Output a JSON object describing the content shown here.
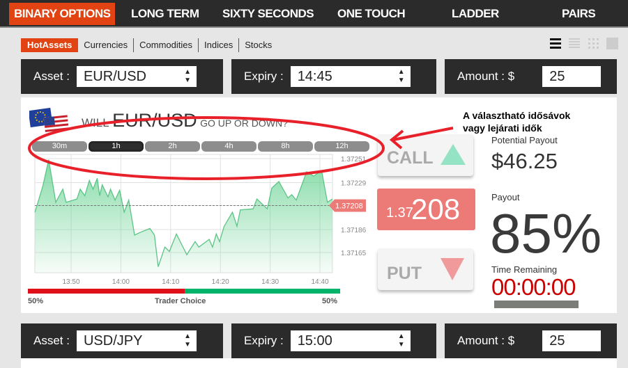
{
  "nav": {
    "items": [
      "BINARY OPTIONS",
      "LONG TERM",
      "SIXTY SECONDS",
      "ONE TOUCH",
      "LADDER",
      "PAIRS"
    ],
    "active": "BINARY OPTIONS",
    "accent": "#e24312"
  },
  "subnav": {
    "items": [
      "HotAssets",
      "Currencies",
      "Commodities",
      "Indices",
      "Stocks"
    ],
    "active": "HotAssets"
  },
  "view_icons": [
    "list-view-icon",
    "compact-list-icon",
    "grid-view-icon",
    "tile-view-icon"
  ],
  "trade1": {
    "asset_label": "Asset :",
    "asset": "EUR/USD",
    "expiry_label": "Expiry :",
    "expiry": "14:45",
    "amount_label": "Amount : $",
    "amount": "25"
  },
  "trade2": {
    "asset_label": "Asset :",
    "asset": "USD/JPY",
    "expiry_label": "Expiry :",
    "expiry": "15:00",
    "amount_label": "Amount : $",
    "amount": "25"
  },
  "question": {
    "will": "WILL",
    "pair": "EUR/USD",
    "rest": "GO UP OR DOWN?"
  },
  "timeframes": [
    "30m",
    "1h",
    "2h",
    "4h",
    "8h",
    "12h"
  ],
  "active_timeframe": "1h",
  "chart_data": {
    "type": "area",
    "x_ticks": [
      "13:50",
      "14:00",
      "14:10",
      "14:20",
      "14:30",
      "14:40"
    ],
    "y_ticks": [
      "1.37251",
      "1.37229",
      "1.37208",
      "1.37186",
      "1.37165"
    ],
    "current_price": "1.37208",
    "series_color": "#5ccf8a",
    "points": [
      [
        "13:42:45",
        1.37202
      ],
      [
        "13:44:20",
        1.37226
      ],
      [
        "13:45:30",
        1.3725
      ],
      [
        "13:46:55",
        1.37211
      ],
      [
        "13:48:20",
        1.37223
      ],
      [
        "13:49:00",
        1.37211
      ],
      [
        "13:51:10",
        1.37214
      ],
      [
        "13:51:50",
        1.37223
      ],
      [
        "13:52:45",
        1.37217
      ],
      [
        "13:53:40",
        1.37231
      ],
      [
        "13:54:25",
        1.37223
      ],
      [
        "13:55:15",
        1.37233
      ],
      [
        "13:55:45",
        1.37217
      ],
      [
        "13:56:15",
        1.37227
      ],
      [
        "13:57:25",
        1.37216
      ],
      [
        "13:57:55",
        1.37223
      ],
      [
        "13:58:50",
        1.37213
      ],
      [
        "13:59:45",
        1.37222
      ],
      [
        "14:00:40",
        1.37202
      ],
      [
        "14:01:35",
        1.37213
      ],
      [
        "14:02:45",
        1.37181
      ],
      [
        "14:04:10",
        1.37184
      ],
      [
        "14:05:50",
        1.37187
      ],
      [
        "14:06:45",
        1.37181
      ],
      [
        "14:07:30",
        1.37152
      ],
      [
        "14:08:50",
        1.3717
      ],
      [
        "14:09:45",
        1.37166
      ],
      [
        "14:11:10",
        1.37182
      ],
      [
        "14:13:15",
        1.37163
      ],
      [
        "14:14:55",
        1.37175
      ],
      [
        "14:15:40",
        1.3717
      ],
      [
        "14:17:45",
        1.37177
      ],
      [
        "14:18:25",
        1.3717
      ],
      [
        "14:19:10",
        1.37182
      ],
      [
        "14:19:50",
        1.37175
      ],
      [
        "14:20:45",
        1.37189
      ],
      [
        "14:22:25",
        1.37202
      ],
      [
        "14:23:20",
        1.37189
      ],
      [
        "14:24:00",
        1.37204
      ],
      [
        "14:26:35",
        1.37205
      ],
      [
        "14:27:20",
        1.37214
      ],
      [
        "14:29:25",
        1.37205
      ],
      [
        "14:30:20",
        1.37224
      ],
      [
        "14:31:45",
        1.3723
      ],
      [
        "14:33:35",
        1.37215
      ],
      [
        "14:34:20",
        1.37218
      ],
      [
        "14:35:15",
        1.37213
      ],
      [
        "14:37:20",
        1.37239
      ],
      [
        "14:38:45",
        1.37235
      ],
      [
        "14:40:20",
        1.3724
      ],
      [
        "14:41:30",
        1.37211
      ],
      [
        "14:42:30",
        1.37214
      ]
    ]
  },
  "sentiment": {
    "left": "50%",
    "label": "Trader Choice",
    "right": "50%",
    "put_share": 50,
    "call_share": 50
  },
  "call_label": "CALL",
  "put_label": "PUT",
  "price_prefix": "1.37",
  "price_main": "208",
  "potential_payout_label": "Potential Payout",
  "potential_payout": "$46.25",
  "payout_label": "Payout",
  "payout": "85%",
  "time_remaining_label": "Time Remaining",
  "time_remaining": "00:00:00",
  "annotation": {
    "line1": "A választható idősávok",
    "line2": "vagy lejárati idők",
    "color": "#e8202a"
  }
}
